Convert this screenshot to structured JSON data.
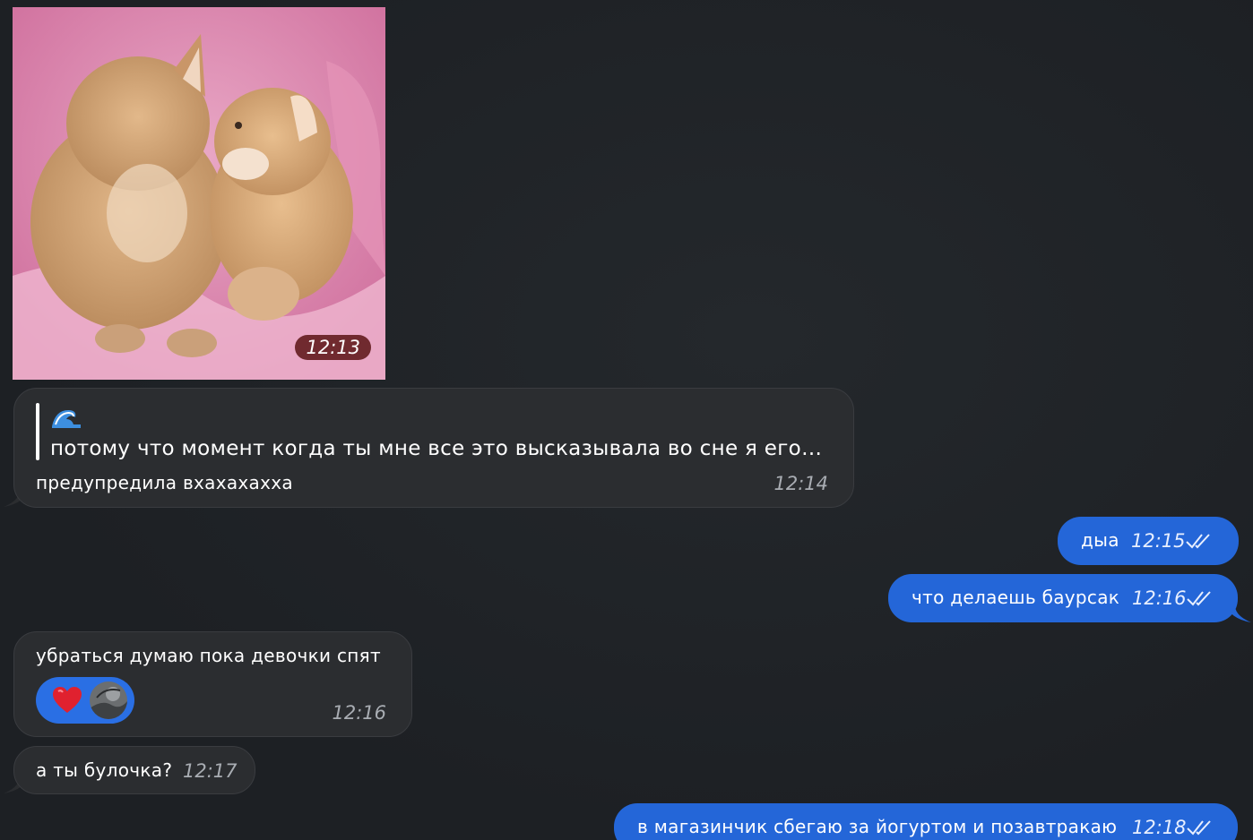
{
  "photo_message": {
    "time": "12:13",
    "icon": "kittens-photo"
  },
  "messages": [
    {
      "direction": "in",
      "quote_icon": "wave-emoji",
      "quote_text": "потому что момент когда ты мне все это высказывала во сне я его…",
      "text": "предупредила вхахахахха",
      "time": "12:14"
    },
    {
      "direction": "out",
      "text": "дыа",
      "time": "12:15",
      "status": "read-double-check"
    },
    {
      "direction": "out",
      "text": "что делаешь баурсак",
      "time": "12:16",
      "status": "read-double-check"
    },
    {
      "direction": "in",
      "text": "убраться думаю пока девочки спят",
      "time": "12:16",
      "reaction": {
        "emoji": "heart-icon",
        "avatar": "user-avatar"
      }
    },
    {
      "direction": "in",
      "text": "а ты булочка?",
      "time": "12:17"
    },
    {
      "direction": "out",
      "text": "в магазинчик сбегаю за йогуртом и позавтракаю",
      "time": "12:18",
      "status": "read-double-check"
    }
  ],
  "colors": {
    "background": "#1f2226",
    "incoming_bubble": "#2b2d30",
    "outgoing_bubble": "#2466d8",
    "reaction_pill": "#2a6fe4"
  }
}
